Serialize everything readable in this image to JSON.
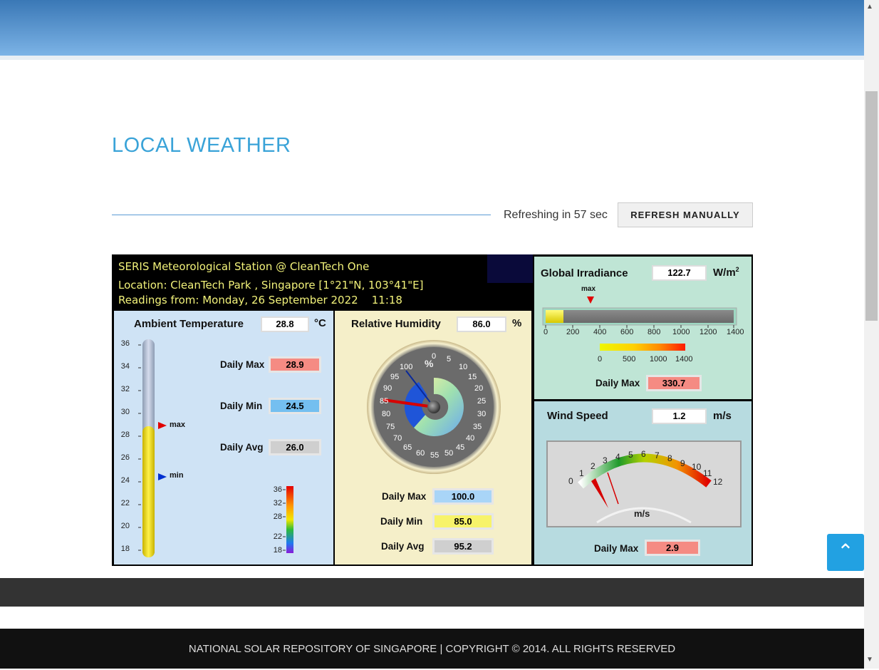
{
  "page": {
    "title": "LOCAL WEATHER",
    "refresh_text": "Refreshing in 57 sec",
    "refresh_button": "REFRESH MANUALLY",
    "footer": "NATIONAL SOLAR REPOSITORY OF SINGAPORE | COPYRIGHT © 2014. ALL RIGHTS RESERVED"
  },
  "station": {
    "name": "SERIS Meteorological Station @ CleanTech One",
    "location": "Location: CleanTech Park , Singapore [1°21\"N, 103°41\"E]",
    "readings": "Readings from: Monday, 26 September 2022    11:18"
  },
  "temperature": {
    "label": "Ambient Temperature",
    "value": "28.8",
    "unit": "°C",
    "daily_max_label": "Daily Max",
    "daily_max": "28.9",
    "daily_min_label": "Daily Min",
    "daily_min": "24.5",
    "daily_avg_label": "Daily Avg",
    "daily_avg": "26.0",
    "max_marker": "max",
    "min_marker": "min",
    "scale_ticks": [
      "36",
      "34",
      "32",
      "30",
      "28",
      "26",
      "24",
      "22",
      "20",
      "18"
    ],
    "color_scale_ticks": [
      "36",
      "32",
      "28",
      "22",
      "18"
    ]
  },
  "humidity": {
    "label": "Relative Humidity",
    "value": "86.0",
    "unit": "%",
    "daily_max_label": "Daily Max",
    "daily_max": "100.0",
    "daily_min_label": "Daily Min",
    "daily_min": "85.0",
    "daily_avg_label": "Daily Avg",
    "daily_avg": "95.2",
    "dial_unit": "%",
    "dial_ticks": [
      "0",
      "5",
      "10",
      "15",
      "20",
      "25",
      "30",
      "35",
      "40",
      "45",
      "50",
      "55",
      "60",
      "65",
      "70",
      "75",
      "80",
      "85",
      "90",
      "95",
      "100"
    ]
  },
  "irradiance": {
    "label": "Global Irradiance",
    "value": "122.7",
    "unit": "W/m",
    "unit_sup": "2",
    "max_marker": "max",
    "bar_ticks": [
      "0",
      "200",
      "400",
      "600",
      "800",
      "1000",
      "1200",
      "1400"
    ],
    "color_ticks": [
      "0",
      "500",
      "1000",
      "1400"
    ],
    "daily_max_label": "Daily Max",
    "daily_max": "330.7"
  },
  "wind": {
    "label": "Wind Speed",
    "value": "1.2",
    "unit": "m/s",
    "dial_unit": "m/s",
    "dial_ticks": [
      "0",
      "1",
      "2",
      "3",
      "4",
      "5",
      "6",
      "7",
      "8",
      "9",
      "10",
      "11",
      "12"
    ],
    "daily_max_label": "Daily Max",
    "daily_max": "2.9"
  },
  "colors": {
    "accent": "#3aa3d8",
    "station_text": "#f2f27a",
    "max_red": "#f58b83"
  },
  "icons": {
    "back_to_top": "chevron-up-icon",
    "scroll_up": "scroll-up-arrow-icon",
    "scroll_down": "scroll-down-arrow-icon"
  }
}
